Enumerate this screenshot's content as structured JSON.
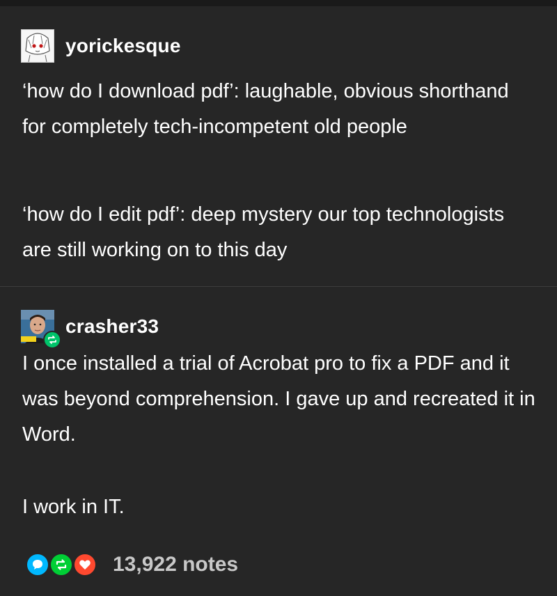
{
  "posts": [
    {
      "username": "yorickesque",
      "paragraphs": [
        "‘how do I download pdf’: laughable, obvious shorthand for completely tech-incompetent old people",
        "‘how do I edit pdf’: deep mystery our top technologists are still working on to this day"
      ]
    },
    {
      "username": "crasher33",
      "paragraphs": [
        "I once installed a trial of Acrobat pro to fix a PDF and it was beyond comprehension. I gave up and recreated it in Word.",
        "I work in IT."
      ]
    }
  ],
  "notes": {
    "count": "13,922 notes",
    "icons": [
      "reply-icon",
      "reblog-icon",
      "like-icon"
    ]
  },
  "colors": {
    "background": "#262626",
    "text": "#ffffff",
    "notes_text": "#c8c8c8",
    "reply": "#00b8ff",
    "reblog": "#00cf35",
    "like": "#ff492f"
  }
}
